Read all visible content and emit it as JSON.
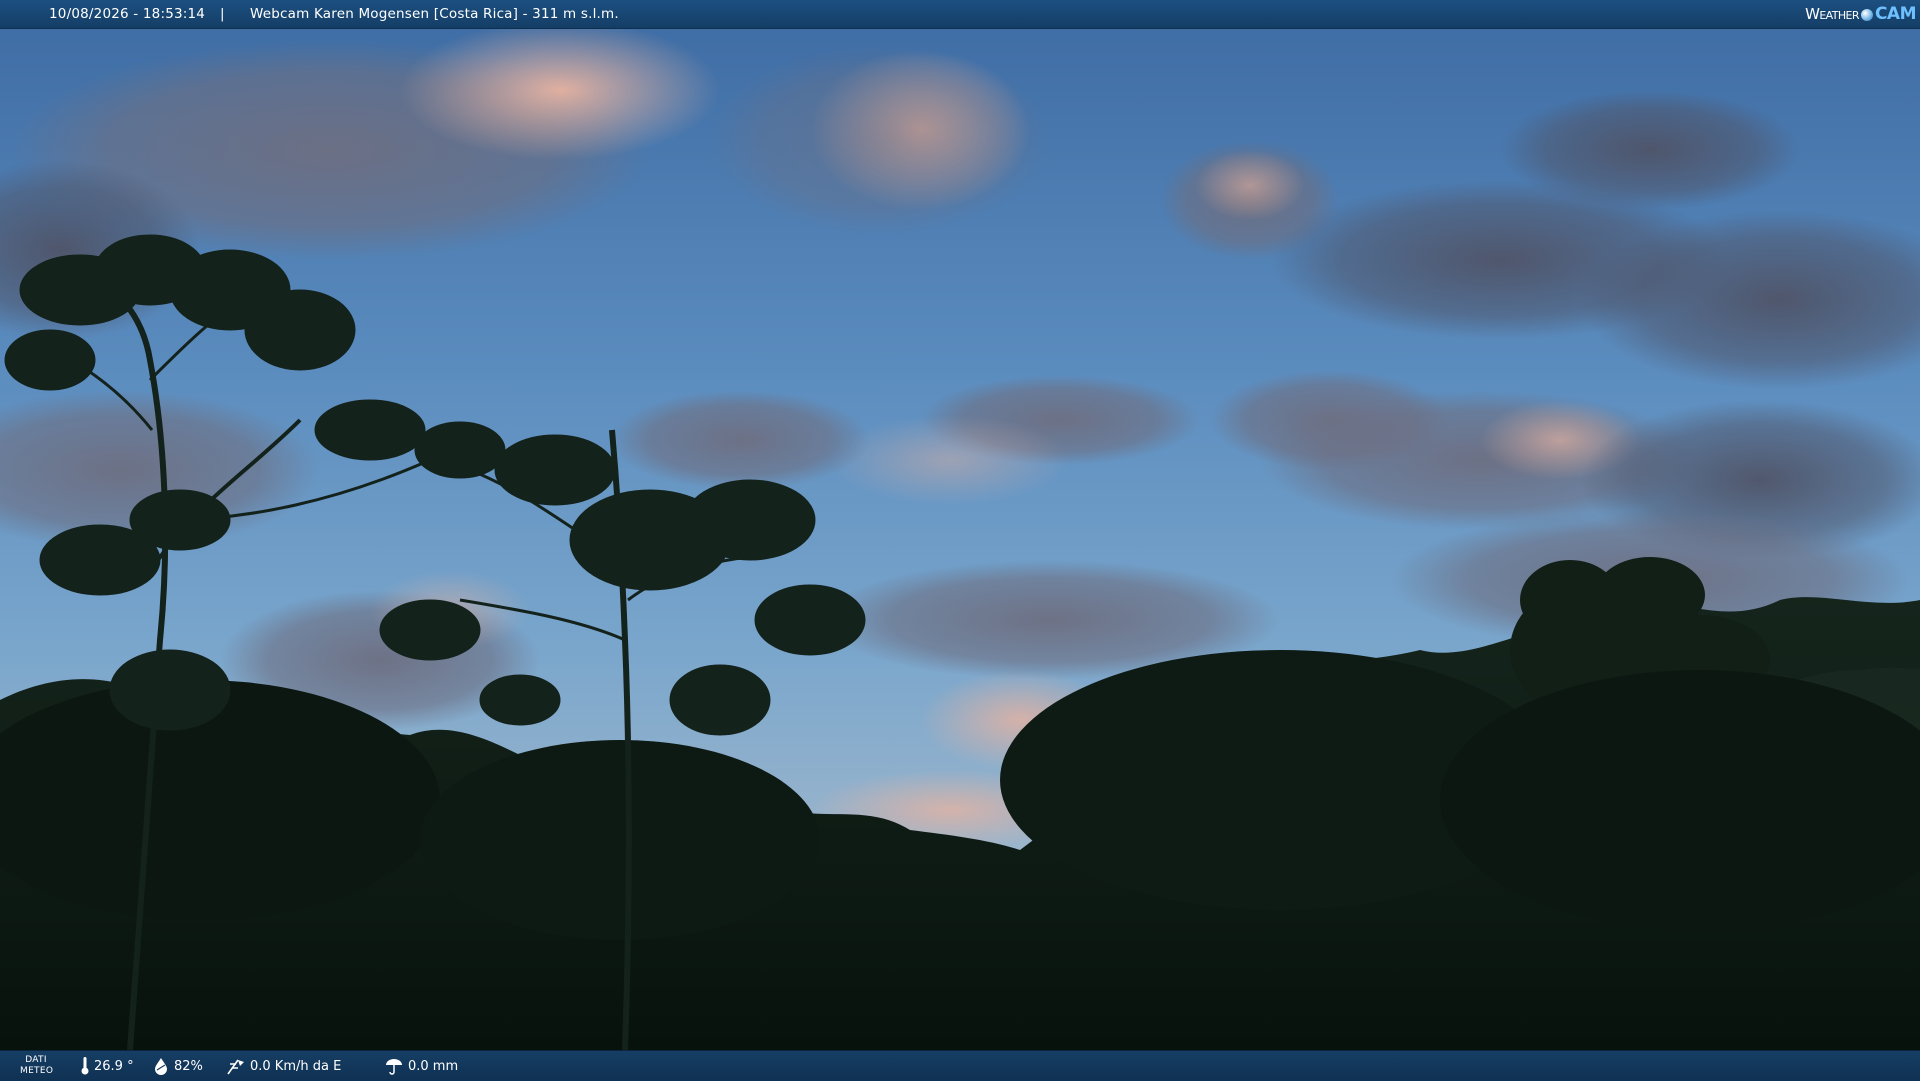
{
  "top_bar": {
    "timestamp": "10/08/2026 - 18:53:14",
    "separator": "|",
    "title": "Webcam Karen Mogensen [Costa Rica]  - 311 m s.l.m."
  },
  "logo": {
    "word": "Weather",
    "cam": "CAM"
  },
  "bottom_bar": {
    "label_line1": "DATI",
    "label_line2": "METEO",
    "temperature": "26.9 °",
    "humidity": "82%",
    "wind": "0.0 Km/h da E",
    "rain": "0.0 mm"
  },
  "icons": {
    "thermometer": "thermometer-icon",
    "humidity": "humidity-icon",
    "wind": "wind-icon",
    "rain": "rain-icon"
  },
  "colors": {
    "bar": "#163e64",
    "sky_top": "#3e6ea6",
    "sky_mid": "#6f9ec8",
    "forest": "#0d1b14"
  }
}
